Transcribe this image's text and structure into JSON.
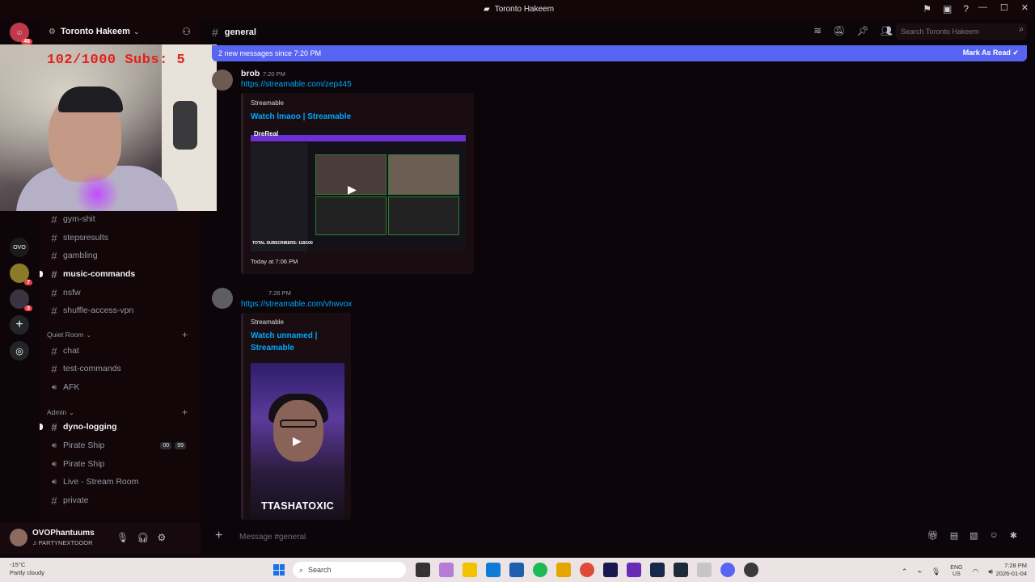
{
  "window": {
    "title": "Toronto Hakeem",
    "controls": [
      "—",
      "☐",
      "✕"
    ]
  },
  "server": {
    "name": "Toronto Hakeem",
    "rail_badges": [
      "46",
      "7",
      "3"
    ]
  },
  "webcam": {
    "overlay_text": "102/1000  Subs: 5"
  },
  "channels": [
    {
      "name": "gym-shit",
      "type": "text",
      "unread": false
    },
    {
      "name": "stepsresults",
      "type": "text",
      "unread": false
    },
    {
      "name": "gambling",
      "type": "text",
      "unread": false
    },
    {
      "name": "music-commands",
      "type": "text",
      "unread": true
    },
    {
      "name": "nsfw",
      "type": "text",
      "unread": false
    },
    {
      "name": "shuffle-access-vpn",
      "type": "text",
      "unread": false
    }
  ],
  "categories": {
    "quiet_room": "Quiet Room",
    "admin": "Admin"
  },
  "quiet_room_channels": [
    {
      "name": "chat",
      "type": "text"
    },
    {
      "name": "test-commands",
      "type": "text"
    },
    {
      "name": "AFK",
      "type": "voice"
    }
  ],
  "admin_channels": [
    {
      "name": "dyno-logging",
      "type": "text",
      "unread": true
    },
    {
      "name": "Pirate Ship",
      "type": "voice",
      "counts": [
        "00",
        "99"
      ]
    },
    {
      "name": "Pirate Ship",
      "type": "voice"
    },
    {
      "name": "Live - Stream Room",
      "type": "voice"
    },
    {
      "name": "private",
      "type": "text"
    }
  ],
  "user": {
    "name": "OVOPhantuums",
    "status": "PARTYNEXTDOOR"
  },
  "chat": {
    "channel": "general",
    "search_placeholder": "Search Toronto Hakeem",
    "new_messages": "2 new messages since 7:20 PM",
    "mark_read": "Mark As Read",
    "composer_placeholder": "Message #general"
  },
  "messages": [
    {
      "author": "brob",
      "time": "7:20 PM",
      "link": "https://streamable.com/zep445",
      "embed": {
        "provider": "Streamable",
        "title": "Watch lmaoo | Streamable",
        "footer": "Today at 7:06 PM",
        "thumb_label": "DreReal",
        "thumb_subs": "TOTAL SUBSCRIBERS: 118/100"
      }
    },
    {
      "author": "",
      "time": "7:26 PM",
      "link": "https://streamable.com/vhwvox",
      "embed": {
        "provider": "Streamable",
        "title_line1": "Watch unnamed |",
        "title_line2": "Streamable",
        "thumb_caption": "TTASHATOXIC"
      }
    }
  ],
  "taskbar": {
    "temp": "-15°C",
    "weather": "Partly cloudy",
    "search": "Search",
    "lang1": "ENG",
    "lang2": "US",
    "time": "7:28 PM",
    "date": "2026-01-04"
  }
}
